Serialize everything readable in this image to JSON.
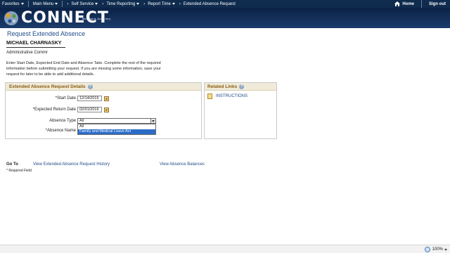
{
  "topnav": {
    "favorites": "Favorites",
    "main_menu": "Main Menu",
    "self_service": "Self Service",
    "time_reporting": "Time Reporting",
    "report_time": "Report Time",
    "current_page": "Extended Absence Request",
    "home": "Home",
    "sign_out": "Sign out"
  },
  "brand": {
    "name": "CONNECT",
    "subtitle": "Maryland Judiciary"
  },
  "page": {
    "title": "Request Extended Absence",
    "employee_name": "MICHAEL CHARNASKY",
    "employee_title": "Administrative Commr",
    "instructions": "Enter Start Date, Expected End Date and Absence Take. Complete the rest of the required information before submitting your request. If you are missing some information, save your request for later to be able to add additional details."
  },
  "details_panel": {
    "heading": "Extended Absence Request Details",
    "start_date_label": "*Start Date",
    "start_date_value": "12/14/2015",
    "return_date_label": "*Expected Return Date",
    "return_date_value": "02/01/2016",
    "absence_type_label": "Absence Type",
    "absence_type_value": "All",
    "absence_name_label": "*Absence Name",
    "absence_type_options": [
      "All",
      "Family and Medical Leave Act"
    ],
    "selected_option_index": 1
  },
  "related_links": {
    "heading": "Related Links",
    "instructions_link": "INSTRUCTIONS"
  },
  "goto": {
    "label": "Go To",
    "history_link": "View Extended Absence Request History",
    "balances_link": "View Absence Balances"
  },
  "required_note": "* Required Field",
  "statusbar": {
    "zoom": "100%"
  },
  "colors": {
    "nav_bg": "#0f2b4e",
    "banner_bg": "#1b3c6b",
    "link": "#1f4c8a",
    "panel_heading_text": "#8a5a12",
    "panel_heading_bg": "#f0ebd8",
    "selection": "#2b6cc7"
  }
}
